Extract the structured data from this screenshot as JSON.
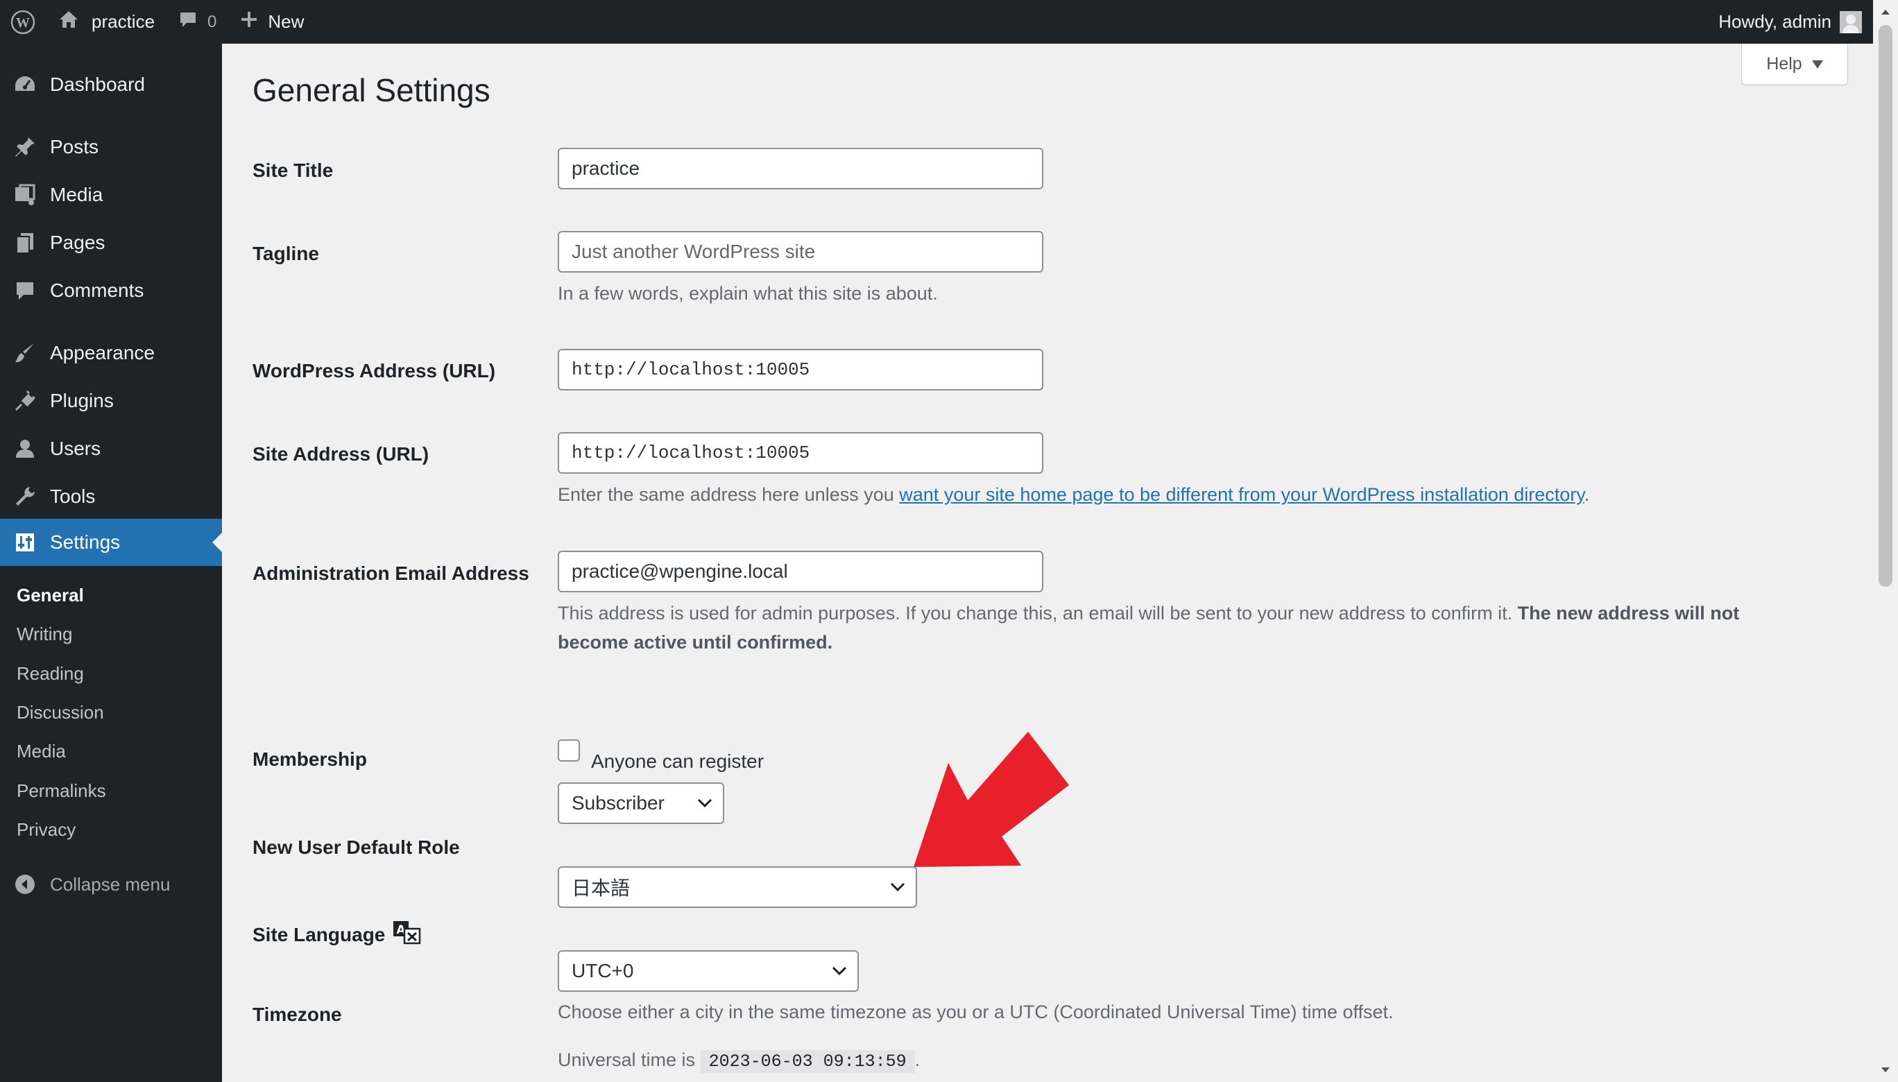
{
  "admin_bar": {
    "site_name": "practice",
    "comments_count": "0",
    "new_label": "New",
    "howdy": "Howdy, admin"
  },
  "sidebar": {
    "items": [
      {
        "label": "Dashboard",
        "icon": "dashboard-icon"
      },
      {
        "label": "Posts",
        "icon": "pin-icon"
      },
      {
        "label": "Media",
        "icon": "media-icon"
      },
      {
        "label": "Pages",
        "icon": "pages-icon"
      },
      {
        "label": "Comments",
        "icon": "comment-icon"
      },
      {
        "label": "Appearance",
        "icon": "brush-icon"
      },
      {
        "label": "Plugins",
        "icon": "plug-icon"
      },
      {
        "label": "Users",
        "icon": "user-icon"
      },
      {
        "label": "Tools",
        "icon": "wrench-icon"
      },
      {
        "label": "Settings",
        "icon": "settings-icon"
      }
    ],
    "submenu": [
      "General",
      "Writing",
      "Reading",
      "Discussion",
      "Media",
      "Permalinks",
      "Privacy"
    ],
    "collapse_label": "Collapse menu"
  },
  "page": {
    "title": "General Settings",
    "help_label": "Help"
  },
  "form": {
    "site_title": {
      "label": "Site Title",
      "value": "practice"
    },
    "tagline": {
      "label": "Tagline",
      "placeholder": "Just another WordPress site",
      "description": "In a few words, explain what this site is about."
    },
    "wp_address": {
      "label": "WordPress Address (URL)",
      "value": "http://localhost:10005"
    },
    "site_address": {
      "label": "Site Address (URL)",
      "value": "http://localhost:10005",
      "description_before": "Enter the same address here unless you ",
      "link_text": "want your site home page to be different from your WordPress installation directory",
      "description_after": "."
    },
    "admin_email": {
      "label": "Administration Email Address",
      "value": "practice@wpengine.local",
      "description_plain": "This address is used for admin purposes. If you change this, an email will be sent to your new address to confirm it. ",
      "description_bold": "The new address will not become active until confirmed."
    },
    "membership": {
      "label": "Membership",
      "checkbox_label": "Anyone can register",
      "checked": false
    },
    "default_role": {
      "label": "New User Default Role",
      "value": "Subscriber"
    },
    "site_language": {
      "label": "Site Language",
      "value": "日本語"
    },
    "timezone": {
      "label": "Timezone",
      "value": "UTC+0",
      "description": "Choose either a city in the same timezone as you or a UTC (Coordinated Universal Time) time offset.",
      "universal_prefix": "Universal time is",
      "universal_time": "2023-06-03 09:13:59",
      "universal_suffix": "."
    }
  },
  "colors": {
    "sidebar_bg": "#1d2327",
    "accent": "#2271b1",
    "arrow": "#e8202a"
  }
}
